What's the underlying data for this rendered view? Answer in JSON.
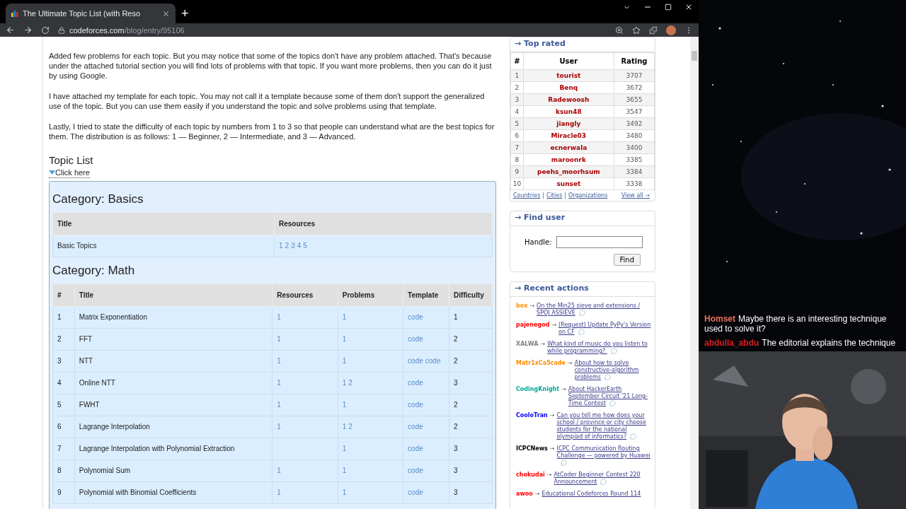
{
  "browser": {
    "tab_title": "The Ultimate Topic List (with Reso",
    "new_tab": "+",
    "url_host": "codeforces.com",
    "url_path": "/blog/entry/95106"
  },
  "article": {
    "paragraphs": [
      "Added few problems for each topic. But you may notice that some of the topics don't have any problem attached. That's because under the attached tutorial section you will find lots of problems with that topic. If you want more problems, then you can do it just by using Google.",
      "I have attached my template for each topic. You may not call it a template because some of them don't support the generalized use of the topic. But you can use them easily if you understand the topic and solve problems using that template.",
      "Lastly, I tried to state the difficulty of each topic by numbers from 1 to 3 so that people can understand what are the best topics for them. The distribution is as follows: 1 — Beginner, 2 — Intermediate, and 3 — Advanced."
    ],
    "heading": "Topic List",
    "spoiler": "Click here"
  },
  "categories": [
    {
      "title": "Category: Basics",
      "columns": [
        "Title",
        "Resources"
      ],
      "rows": [
        [
          "Basic Topics",
          [
            "1",
            "2",
            "3",
            "4",
            "5"
          ]
        ]
      ]
    },
    {
      "title": "Category: Math",
      "columns": [
        "#",
        "Title",
        "Resources",
        "Problems",
        "Template",
        "Difficulty"
      ],
      "rows": [
        [
          "1",
          "Matrix Exponentiation",
          [
            "1"
          ],
          [
            "1"
          ],
          [
            "code"
          ],
          "1"
        ],
        [
          "2",
          "FFT",
          [
            "1"
          ],
          [
            "1"
          ],
          [
            "code"
          ],
          "2"
        ],
        [
          "3",
          "NTT",
          [
            "1"
          ],
          [
            "1"
          ],
          [
            "code",
            "code"
          ],
          "2"
        ],
        [
          "4",
          "Online NTT",
          [
            "1"
          ],
          [
            "1",
            "2"
          ],
          [
            "code"
          ],
          "3"
        ],
        [
          "5",
          "FWHT",
          [
            "1"
          ],
          [
            "1"
          ],
          [
            "code"
          ],
          "2"
        ],
        [
          "6",
          "Lagrange Interpolation",
          [
            "1"
          ],
          [
            "1",
            "2"
          ],
          [
            "code"
          ],
          "2"
        ],
        [
          "7",
          "Lagrange Interpolation with Polynomial Extraction",
          null,
          [
            "1"
          ],
          [
            "code"
          ],
          "3"
        ],
        [
          "8",
          "Polynomial Sum",
          [
            "1"
          ],
          [
            "1"
          ],
          [
            "code"
          ],
          "3"
        ],
        [
          "9",
          "Polynomial with Binomial Coefficients",
          [
            "1"
          ],
          [
            "1"
          ],
          [
            "code"
          ],
          "3"
        ]
      ]
    }
  ],
  "top_rated": {
    "title": "→ Top rated",
    "columns": [
      "#",
      "User",
      "Rating"
    ],
    "rows": [
      [
        "1",
        "tourist",
        "3707"
      ],
      [
        "2",
        "Benq",
        "3672"
      ],
      [
        "3",
        "Radewoosh",
        "3655"
      ],
      [
        "4",
        "ksun48",
        "3547"
      ],
      [
        "5",
        "jiangly",
        "3492"
      ],
      [
        "6",
        "Miracle03",
        "3480"
      ],
      [
        "7",
        "ecnerwala",
        "3400"
      ],
      [
        "8",
        "maroonrk",
        "3385"
      ],
      [
        "9",
        "peehs_moorhsum",
        "3384"
      ],
      [
        "10",
        "sunset",
        "3338"
      ]
    ],
    "footer_links": [
      "Countries",
      "Cities",
      "Organizations"
    ],
    "separator": "|",
    "view_all": "View all →"
  },
  "find_user": {
    "title": "→ Find user",
    "label": "Handle:",
    "button": "Find"
  },
  "recent_actions": {
    "title": "→ Recent actions",
    "arrow": "→",
    "items": [
      {
        "user": "box",
        "color": "#ff8c00",
        "title": "On the Min25 sieve and extensions / SPOJ ASSIEVE"
      },
      {
        "user": "pajenegod",
        "color": "#ff0000",
        "title": "(Request) Update PyPy's Version on CF"
      },
      {
        "user": "XALWA",
        "color": "#808080",
        "title": "What kind of music do you listen to while programming? "
      },
      {
        "user": "Matr1xCa5cade",
        "color": "#ff8c00",
        "title": "About how to solve constructive-algorithm problems"
      },
      {
        "user": "CodingKnight",
        "color": "#03a89e",
        "title": "About HackerEarth September Circuit '21 Long-Time Contest"
      },
      {
        "user": "CooloTran",
        "color": "#0000ff",
        "title": "Can you tell me how does your school / province or city choose students for the national olympiad of informatics?"
      },
      {
        "user": "ICPCNews",
        "color": "#000000",
        "title": "ICPC Communication Routing Challenge — powered by Huawei"
      },
      {
        "user": "chokudai",
        "color": "#ff0000",
        "title": "AtCoder Beginner Contest 220 Announcement"
      },
      {
        "user": "awoo",
        "color": "#ff0000",
        "title": "Educational Codeforces Round 114"
      }
    ]
  },
  "chat": [
    {
      "user": "Homset",
      "color": "#e8735a",
      "text": "Maybe there is an interesting technique used to solve it?"
    },
    {
      "user": "abdulla_abdu",
      "color": "#d81e1e",
      "text": "The editorial explains the technique"
    }
  ]
}
